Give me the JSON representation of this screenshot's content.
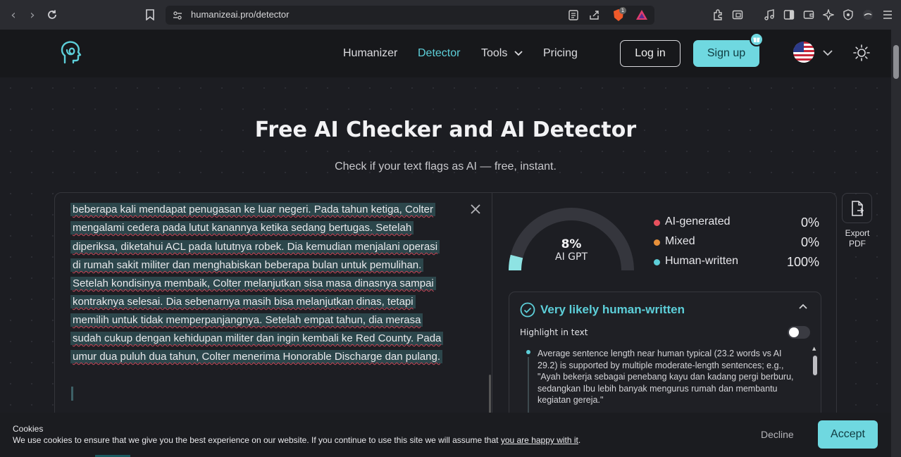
{
  "browser": {
    "url": "humanizeai.pro/detector",
    "brave_badge": "1"
  },
  "header": {
    "nav": [
      "Humanizer",
      "Detector",
      "Tools",
      "Pricing"
    ],
    "login_label": "Log in",
    "signup_label": "Sign up"
  },
  "hero": {
    "title": "Free AI Checker and AI Detector",
    "subtitle": "Check if your text flags as AI — free, instant."
  },
  "editor": {
    "lines": [
      "beberapa kali mendapat penugasan ke luar negeri. Pada tahun ketiga, Colter",
      "mengalami cedera pada lutut kanannya ketika sedang bertugas. Setelah",
      "diperiksa, diketahui ACL pada lututnya robek. Dia kemudian menjalani operasi",
      "di rumah sakit militer dan menghabiskan beberapa bulan untuk pemulihan.",
      "Setelah kondisinya membaik, Colter melanjutkan sisa masa dinasnya sampai",
      "kontraknya selesai. Dia sebenarnya masih bisa melanjutkan dinas, tetapi",
      "memilih untuk tidak memperpanjangnya. Setelah empat tahun, dia merasa",
      "sudah cukup dengan kehidupan militer dan ingin kembali ke Red County. Pada",
      "umur dua puluh dua tahun, Colter menerima Honorable Discharge dan pulang."
    ]
  },
  "results": {
    "gauge": {
      "percent_text": "8%",
      "label": "AI GPT",
      "value": 0.08
    },
    "legend": [
      {
        "name": "AI-generated",
        "value": "0%",
        "color": "#e8515e"
      },
      {
        "name": "Mixed",
        "value": "0%",
        "color": "#e8913a"
      },
      {
        "name": "Human-written",
        "value": "100%",
        "color": "#5dcfd9"
      }
    ],
    "verdict": "Very likely human-written",
    "highlight_label": "Highlight in text",
    "highlight_on": false,
    "reason": "Average sentence length near human typical (23.2 words vs AI 29.2) is supported by multiple moderate-length sentences; e.g., \"Ayah bekerja sebagai penebang kayu dan kadang pergi berburu, sedangkan Ibu lebih banyak mengurus rumah dan membantu kegiatan gereja.\""
  },
  "export": {
    "label_line1": "Export",
    "label_line2": "PDF"
  },
  "cookie": {
    "title": "Cookies",
    "text": "We use cookies to ensure that we give you the best experience on our website. If you continue to use this site we will assume that ",
    "link": "you are happy with it",
    "text_end": ".",
    "decline_label": "Decline",
    "accept_label": "Accept"
  },
  "colors": {
    "accent": "#6fd8e0",
    "accent_text": "#5dcfd9",
    "background": "#1c1d22"
  }
}
